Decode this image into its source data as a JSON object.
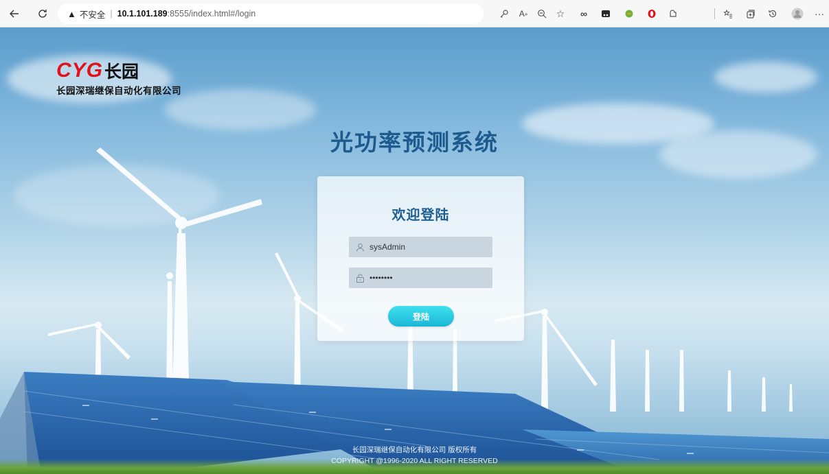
{
  "browser": {
    "security_warning": "不安全",
    "url_host": "10.1.101.189",
    "url_rest": ":8555/index.html#/login",
    "icons": [
      "back-icon",
      "refresh-icon",
      "key-icon",
      "read-aloud-icon",
      "zoom-icon",
      "favorite-add-icon",
      "infinity-icon",
      "extension-icon",
      "extension-icon",
      "opera-icon",
      "extension-icon",
      "favorites-icon",
      "collections-icon",
      "history-icon",
      "profile-icon",
      "more-icon"
    ]
  },
  "brand": {
    "logo_latin": "CYG",
    "logo_cn": "长园",
    "company": "长园深瑞继保自动化有限公司",
    "logo_color": "#e0121a"
  },
  "system_title": "光功率预测系统",
  "login": {
    "welcome": "欢迎登陆",
    "username_value": "sysAdmin",
    "password_value": "••••••••",
    "submit_label": "登陆",
    "accent_color": "#1ab7d6"
  },
  "footer": {
    "line1": "长园深瑞继保自动化有限公司 版权所有",
    "line2": "COPYRIGHT @1996-2020 ALL RIGHT RESERVED"
  }
}
